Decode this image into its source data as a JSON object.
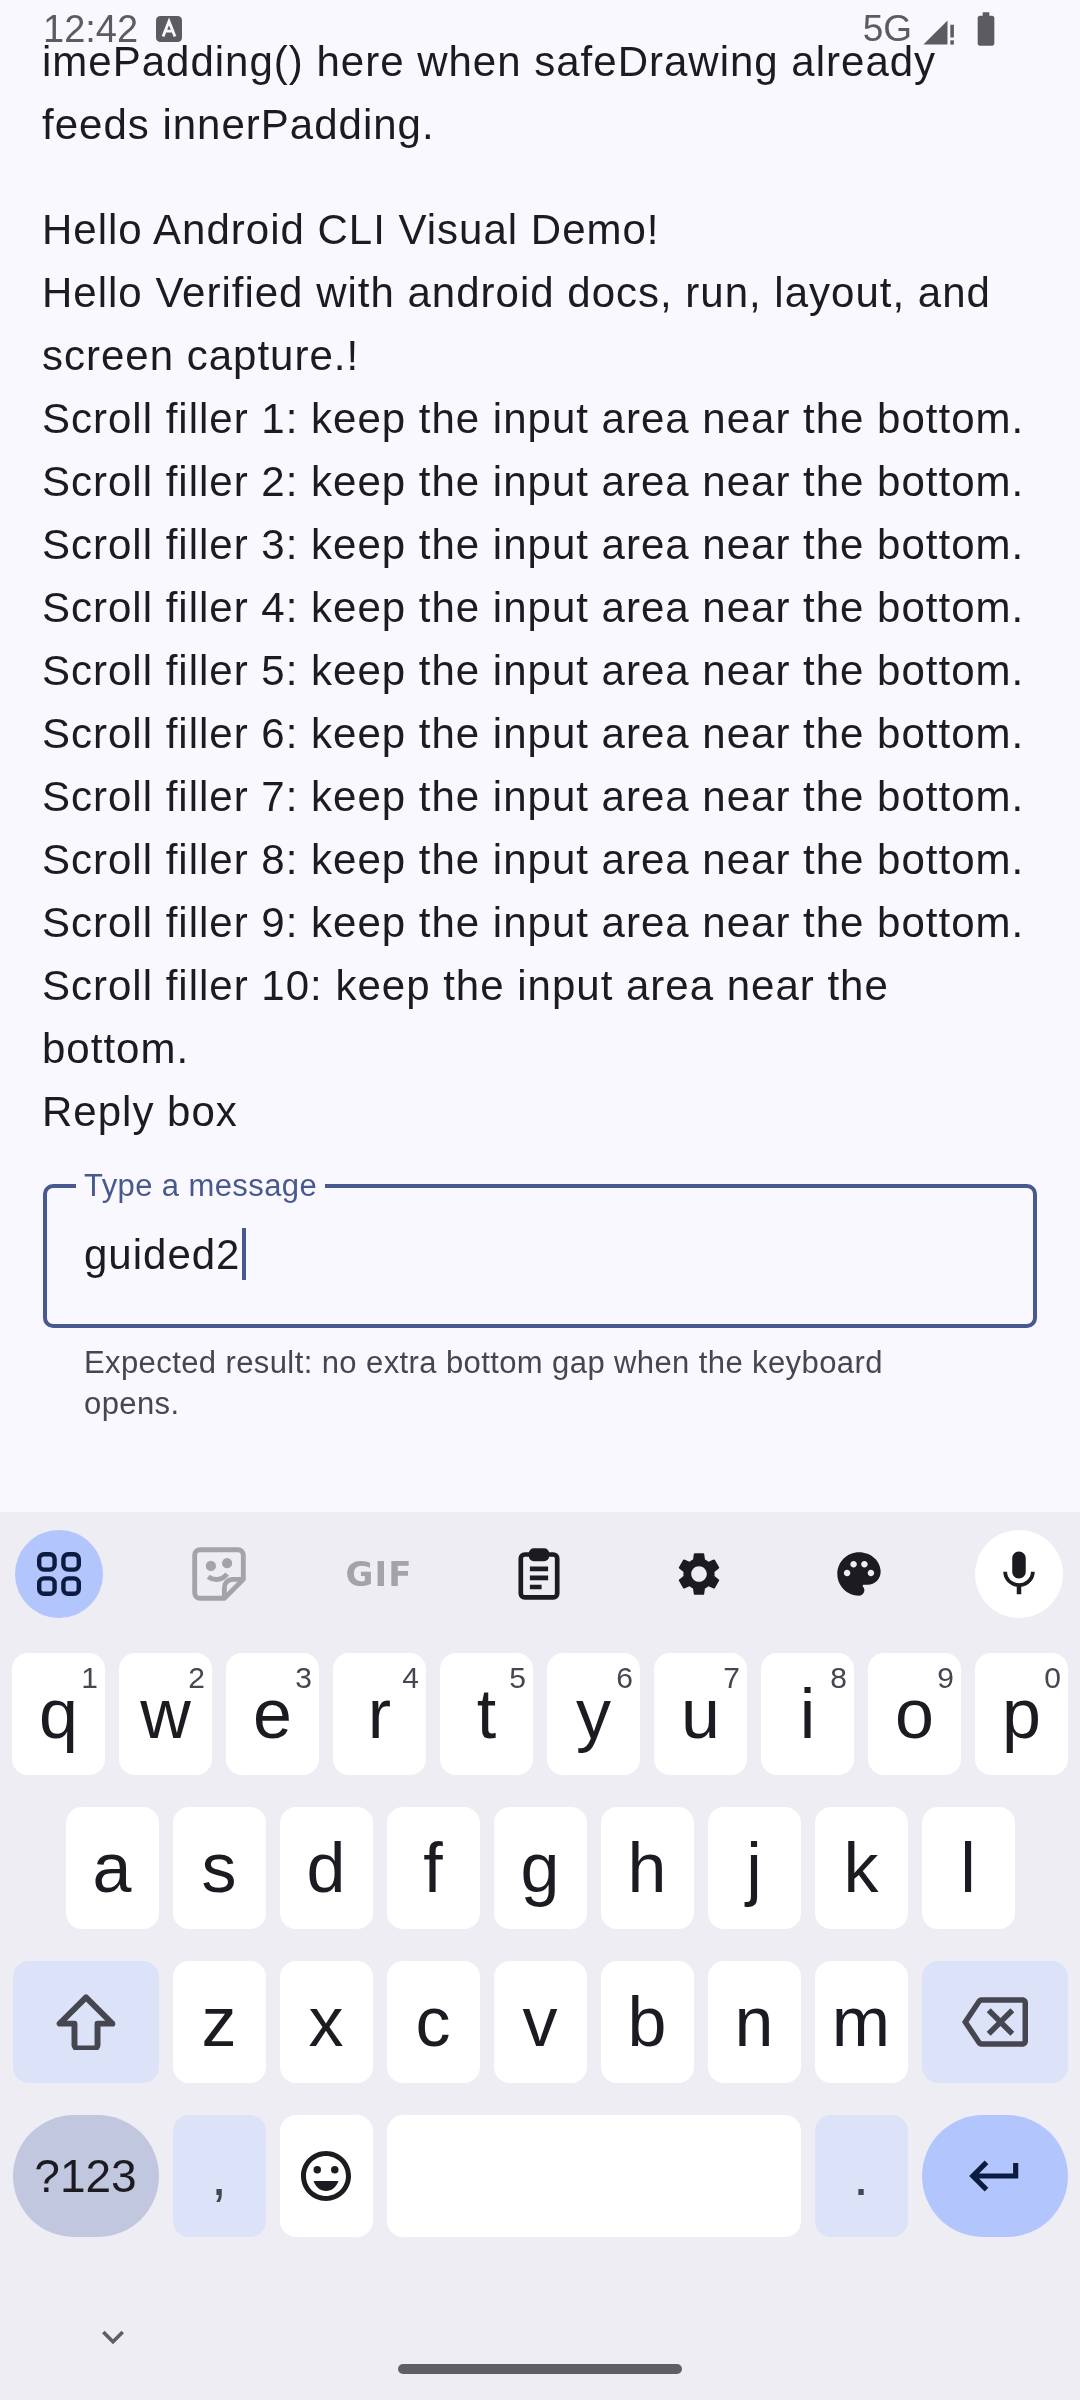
{
  "status_bar": {
    "time": "12:42",
    "network": "5G"
  },
  "paragraphs": [
    {
      "lines": [
        "imePadding() here when safeDrawing already",
        "feeds innerPadding."
      ]
    },
    {
      "lines": [
        "Hello Android CLI Visual Demo!",
        "Hello Verified with android docs, run, layout, and screen capture.!",
        "Scroll filler 1: keep the input area near the bottom.",
        "Scroll filler 2: keep the input area near the bottom.",
        "Scroll filler 3: keep the input area near the bottom.",
        "Scroll filler 4: keep the input area near the bottom.",
        "Scroll filler 5: keep the input area near the bottom.",
        "Scroll filler 6: keep the input area near the bottom.",
        "Scroll filler 7: keep the input area near the bottom.",
        "Scroll filler 8: keep the input area near the bottom.",
        "Scroll filler 9: keep the input area near the bottom.",
        "Scroll filler 10: keep the input area near the bottom.",
        "Reply box"
      ]
    }
  ],
  "reply_field": {
    "label": "Type a message",
    "value": "guided2",
    "focused": true,
    "supporting_text": "Expected result: no extra bottom gap when the keyboard opens."
  },
  "keyboard": {
    "toolbar": [
      {
        "kind": "apps",
        "disabled": false
      },
      {
        "kind": "sticker",
        "disabled": true
      },
      {
        "kind": "gif",
        "label": "GIF",
        "disabled": true
      },
      {
        "kind": "clipboard",
        "disabled": false
      },
      {
        "kind": "settings",
        "disabled": false
      },
      {
        "kind": "theme",
        "disabled": false
      },
      {
        "kind": "mic",
        "disabled": false
      }
    ],
    "rows": [
      {
        "keys": [
          {
            "kind": "letter",
            "label": "q",
            "hint": "1"
          },
          {
            "kind": "letter",
            "label": "w",
            "hint": "2"
          },
          {
            "kind": "letter",
            "label": "e",
            "hint": "3"
          },
          {
            "kind": "letter",
            "label": "r",
            "hint": "4"
          },
          {
            "kind": "letter",
            "label": "t",
            "hint": "5"
          },
          {
            "kind": "letter",
            "label": "y",
            "hint": "6"
          },
          {
            "kind": "letter",
            "label": "u",
            "hint": "7"
          },
          {
            "kind": "letter",
            "label": "i",
            "hint": "8"
          },
          {
            "kind": "letter",
            "label": "o",
            "hint": "9"
          },
          {
            "kind": "letter",
            "label": "p",
            "hint": "0"
          }
        ]
      },
      {
        "keys": [
          {
            "kind": "letter",
            "label": "a"
          },
          {
            "kind": "letter",
            "label": "s"
          },
          {
            "kind": "letter",
            "label": "d"
          },
          {
            "kind": "letter",
            "label": "f"
          },
          {
            "kind": "letter",
            "label": "g"
          },
          {
            "kind": "letter",
            "label": "h"
          },
          {
            "kind": "letter",
            "label": "j"
          },
          {
            "kind": "letter",
            "label": "k"
          },
          {
            "kind": "letter",
            "label": "l"
          }
        ]
      },
      {
        "keys": [
          {
            "kind": "shift"
          },
          {
            "kind": "letter",
            "label": "z"
          },
          {
            "kind": "letter",
            "label": "x"
          },
          {
            "kind": "letter",
            "label": "c"
          },
          {
            "kind": "letter",
            "label": "v"
          },
          {
            "kind": "letter",
            "label": "b"
          },
          {
            "kind": "letter",
            "label": "n"
          },
          {
            "kind": "letter",
            "label": "m"
          },
          {
            "kind": "backspace"
          }
        ]
      },
      {
        "keys": [
          {
            "kind": "symbols",
            "label": "?123"
          },
          {
            "kind": "punct",
            "label": ","
          },
          {
            "kind": "emoji"
          },
          {
            "kind": "space"
          },
          {
            "kind": "punct",
            "label": "."
          },
          {
            "kind": "enter"
          }
        ]
      }
    ]
  }
}
